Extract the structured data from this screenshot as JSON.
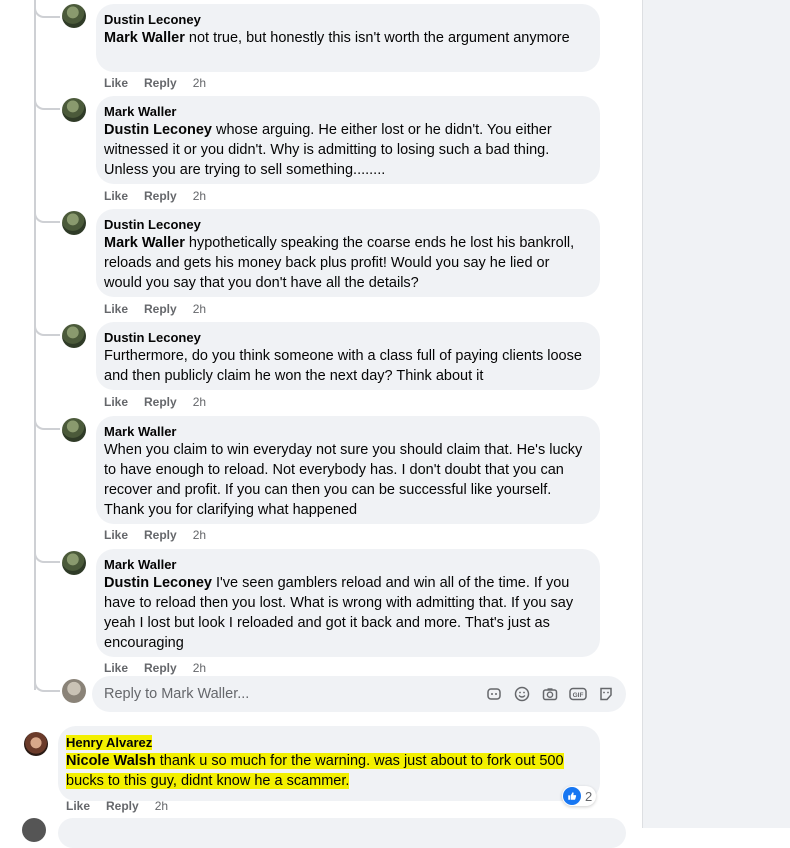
{
  "comments": [
    {
      "author": "Dustin Leconey",
      "mention": "Mark Waller",
      "text": " not true, but honestly this isn't worth the argument anymore",
      "like": "Like",
      "reply": "Reply",
      "time": "2h"
    },
    {
      "author": "Mark Waller",
      "mention": "Dustin Leconey",
      "text": " whose arguing. He either lost or he didn't. You either witnessed it or you didn't. Why is admitting to losing such a bad thing. Unless you are trying to sell something........",
      "like": "Like",
      "reply": "Reply",
      "time": "2h"
    },
    {
      "author": "Dustin Leconey",
      "mention": "Mark Waller",
      "text": " hypothetically speaking the coarse ends he lost his bankroll, reloads and gets his money back plus profit! Would you say he lied or would you say that you don't have all the details?",
      "like": "Like",
      "reply": "Reply",
      "time": "2h"
    },
    {
      "author": "Dustin Leconey",
      "mention": "",
      "text": "Furthermore, do you think someone with a class full of paying clients loose and then publicly claim he won the next day? Think about it",
      "like": "Like",
      "reply": "Reply",
      "time": "2h"
    },
    {
      "author": "Mark Waller",
      "mention": "",
      "text": "When you claim to win everyday not sure you should claim that. He's lucky to have enough to reload. Not everybody has. I don't doubt that you can recover and profit. If you can then you can be successful like yourself. Thank you for clarifying what happened",
      "like": "Like",
      "reply": "Reply",
      "time": "2h"
    },
    {
      "author": "Mark Waller",
      "mention": "Dustin Leconey",
      "text": " I've seen gamblers reload and win all of the time. If you have to reload then you lost. What is wrong with admitting that. If you say yeah I lost but look I reloaded and got it back and more. That's just as encouraging",
      "like": "Like",
      "reply": "Reply",
      "time": "2h"
    }
  ],
  "reply_box": {
    "placeholder": "Reply to Mark Waller..."
  },
  "henry_comment": {
    "author": "Henry Alvarez",
    "mention": "Nicole Walsh",
    "text": " thank u so much for the warning. was just about to fork out 500 bucks to this guy, didnt know he a scammer.",
    "like": "Like",
    "reply": "Reply",
    "time": "2h",
    "reaction_count": "2"
  },
  "colors": {
    "bubble": "#f0f2f5",
    "meta": "#65676b",
    "highlight": "#f3f000",
    "like": "#1877f2"
  }
}
